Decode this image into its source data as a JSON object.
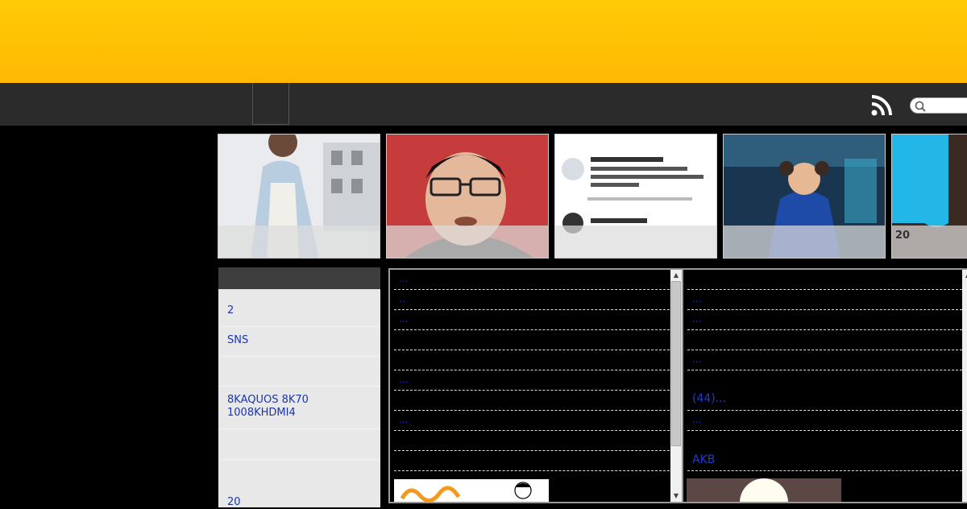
{
  "header": {
    "rss_icon": "rss-icon",
    "search_icon": "search-icon",
    "search_placeholder": ""
  },
  "thumbnails": [
    {
      "icon": "woman-photo",
      "label": ""
    },
    {
      "icon": "man-portrait-photo",
      "label": ""
    },
    {
      "icon": "tweet-screenshot",
      "label": ""
    },
    {
      "icon": "game-character-photo",
      "label": ""
    },
    {
      "icon": "blue-photo",
      "label": "20"
    }
  ],
  "sidebar": {
    "items": [
      {
        "label": "2"
      },
      {
        "label": "SNS"
      },
      {
        "label": "8KAQUOS 8K70 1008KHDMI4"
      },
      {
        "label": "20"
      }
    ]
  },
  "feed_left": {
    "links": [
      "...",
      "..",
      "...",
      "...",
      "..."
    ],
    "image_icon": "manga-banner-image"
  },
  "feed_right": {
    "links": [
      "...",
      "...",
      "...",
      "(44)...",
      "...",
      "AKB"
    ],
    "image_icon": "illustration-image"
  },
  "colors": {
    "banner": "#ffc505",
    "nav": "#2b2b2b",
    "link": "#1a2cc6"
  }
}
